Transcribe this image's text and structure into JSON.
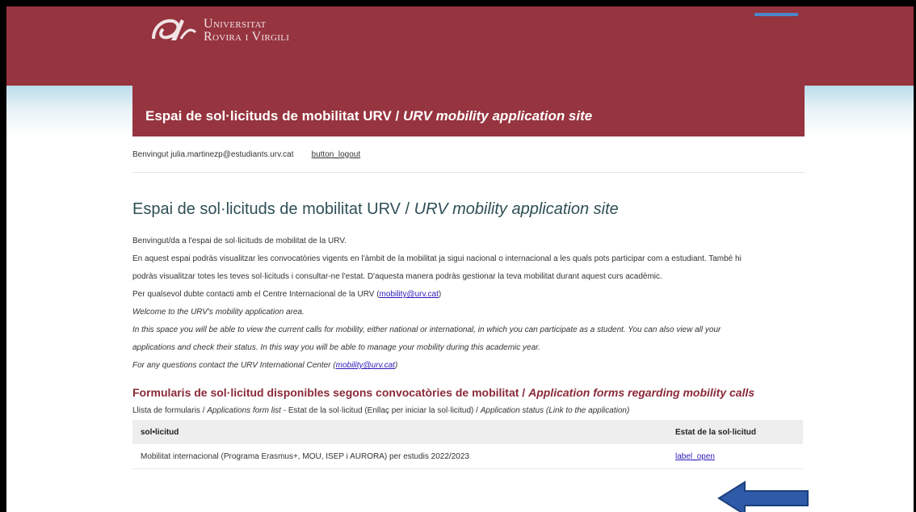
{
  "header": {
    "logo_line1": "Universitat",
    "logo_line2": "Rovira i Virgili"
  },
  "title_bar": {
    "text_plain": "Espai de sol·licituds de mobilitat URV / ",
    "text_italic": "URV mobility application site"
  },
  "userbar": {
    "welcome": "Benvingut julia.martinezp@estudiants.urv.cat",
    "logout_label": "button_logout"
  },
  "main": {
    "heading_plain": "Espai de sol·licituds de mobilitat URV / ",
    "heading_italic": "URV mobility application site",
    "intro": {
      "p1": "Benvingut/da a l'espai de sol·licituds de mobilitat de la URV.",
      "p2": "En aquest espai podràs visualitzar les convocatòries vigents en l'àmbit de la mobilitat ja sigui nacional o internacional a les quals pots participar com a estudiant. També hi",
      "p3": "podràs visualitzar totes les teves sol·licituds i consultar-ne l'estat. D'aquesta manera podràs gestionar la teva mobilitat durant aquest curs acadèmic.",
      "p4_prefix": "Per qualsevol dubte contacti amb el Centre Internacional de la URV (",
      "p4_link": "mobility@urv.cat",
      "p4_suffix": ")",
      "p5": "Welcome to the URV's mobility application area.",
      "p6": "In this space you will be able to view the current calls for mobility, either national or international, in which you can participate as a student. You can also view all your",
      "p7": "applications and check their status. In this way you will be able to manage your mobility during this academic year.",
      "p8_prefix": "For any questions contact the URV International Center (",
      "p8_link": "mobility@urv.cat",
      "p8_suffix": ")"
    },
    "forms_heading_plain": "Formularis de sol·licitud disponibles segons convocatòries de mobilitat / ",
    "forms_heading_italic": "Application forms regarding mobility calls",
    "list_desc": {
      "a": "Llista de formularis / ",
      "b": "Applications form list",
      "c": " - Estat de la sol·licitud (Enllaç per iniciar la sol·licitud) / ",
      "d": "Application status (Link to the application)"
    },
    "table": {
      "headers": [
        "sol•licitud",
        "Estat de la sol·licitud"
      ],
      "rows": [
        {
          "name": "Mobilitat internacional (Programa Erasmus+, MOU, ISEP i AURORA) per estudis 2022/2023",
          "status": "label_open"
        }
      ]
    }
  },
  "colors": {
    "brand": "#96343f",
    "heading": "#2f4f56",
    "link": "#2a1ab8",
    "arrow": "#2e5aa8"
  },
  "annotation": {
    "icon": "blue-arrow-left-icon"
  }
}
